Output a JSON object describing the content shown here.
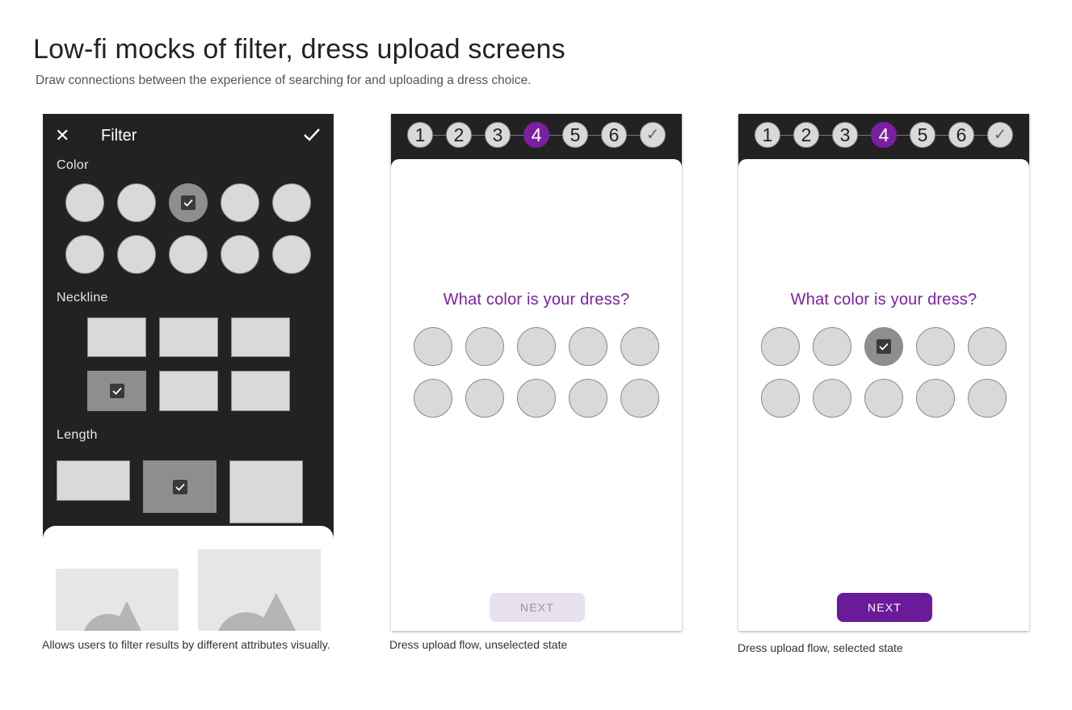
{
  "page": {
    "title": "Low-fi mocks of filter, dress upload screens",
    "subtitle": "Draw connections between the experience of searching for and uploading a dress choice."
  },
  "filter_screen": {
    "header_title": "Filter",
    "sections": {
      "color": "Color",
      "neckline": "Neckline",
      "length": "Length"
    },
    "color_swatches_total": 10,
    "selected_color_index": 3,
    "neckline_options_total": 6,
    "selected_neckline_index": 4,
    "length_options_total": 3,
    "selected_length_index": 2,
    "caption": "Allows users to filter results by different attributes visually."
  },
  "upload_unselected": {
    "steps": [
      "1",
      "2",
      "3",
      "4",
      "5",
      "6",
      "✓"
    ],
    "active_step": "4",
    "question": "What color is your dress?",
    "color_swatches_total": 10,
    "selected_color_index": null,
    "next_label": "NEXT",
    "next_state": "disabled",
    "caption": "Dress upload flow, unselected state"
  },
  "upload_selected": {
    "steps": [
      "1",
      "2",
      "3",
      "4",
      "5",
      "6",
      "✓"
    ],
    "active_step": "4",
    "question": "What color is your dress?",
    "color_swatches_total": 10,
    "selected_color_index": 3,
    "next_label": "NEXT",
    "next_state": "enabled",
    "caption": "Dress upload flow, selected state"
  },
  "colors": {
    "accent_purple": "#7b1fa2",
    "button_purple": "#6a1b9a",
    "dark_panel": "#222222",
    "swatch": "#d9d9d9",
    "swatch_selected": "#8e8e8e"
  }
}
